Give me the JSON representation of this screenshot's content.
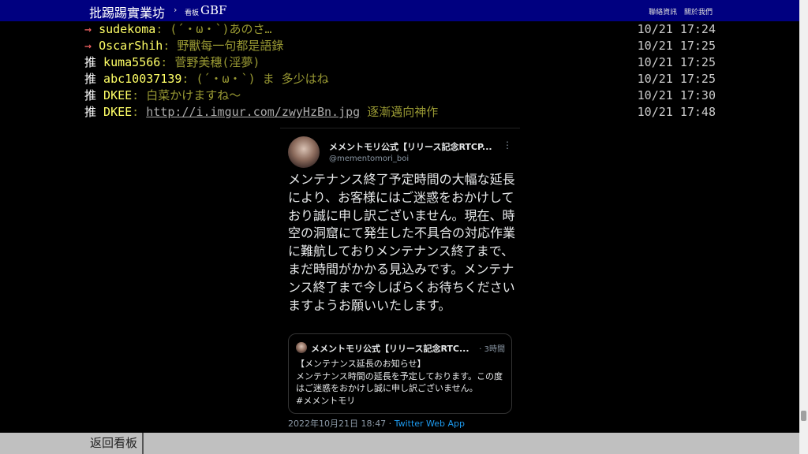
{
  "topbar": {
    "brand": "批踢踢實業坊",
    "separator": "›",
    "board_label": "看板",
    "board_name": "GBF",
    "links": [
      "聯絡資訊",
      "關於我們"
    ]
  },
  "pushes": [
    {
      "tag": "→",
      "user": "sudekoma",
      "content": ": (´・ω・`)あのさ…",
      "time": "10/21 17:24"
    },
    {
      "tag": "→",
      "user": "OscarShih",
      "content": ": 野獸每一句都是語錄",
      "time": "10/21 17:25"
    },
    {
      "tag": "推",
      "user": "kuma5566",
      "content": ": 菅野美穗(淫夢)",
      "time": "10/21 17:25"
    },
    {
      "tag": "推",
      "user": "abc10037139",
      "content": ": (´・ω・`) ま 多少はね",
      "time": "10/21 17:25"
    },
    {
      "tag": "推",
      "user": "DKEE",
      "content": ": 白菜かけますね～",
      "time": "10/21 17:30"
    },
    {
      "tag": "推",
      "user": "DKEE",
      "content": ": ",
      "link": "http://i.imgur.com/zwyHzBn.jpg",
      "content_after": " 逐漸邁向神作",
      "time": "10/21 17:48"
    }
  ],
  "tweet": {
    "name": "メメントモリ公式【リリース記念RTCP...",
    "handle": "@mementomori_boi",
    "more": "⋮",
    "body": "メンテナンス終了予定時間の大幅な延長により、お客様にはご迷惑をおかけしており誠に申し訳ございません。現在、時空の洞窟にて発生した不具合の対応作業に難航しておりメンテナンス終了まで、まだ時間がかかる見込みです。メンテナンス終了まで今しばらくお待ちくださいますようお願いいたします。",
    "quote": {
      "name": "メメントモリ公式【リリース記念RTC...",
      "time": "· 3時間",
      "body": "【メンテナンス延長のお知らせ】\nメンテナンス時間の延長を予定しております。この度はご迷惑をおかけし誠に申し訳ございません。\n#メメントモリ"
    },
    "timestamp": "2022年10月21日 18:47 · ",
    "app": "Twitter Web App"
  },
  "bottombar": {
    "back_label": "返回看板"
  },
  "colors": {
    "topbar_bg": "#000080",
    "push_tag_arrow": "#ff6666",
    "push_user": "#ffff66",
    "push_content": "#999933",
    "twitter_blue": "#1d9bf0"
  }
}
